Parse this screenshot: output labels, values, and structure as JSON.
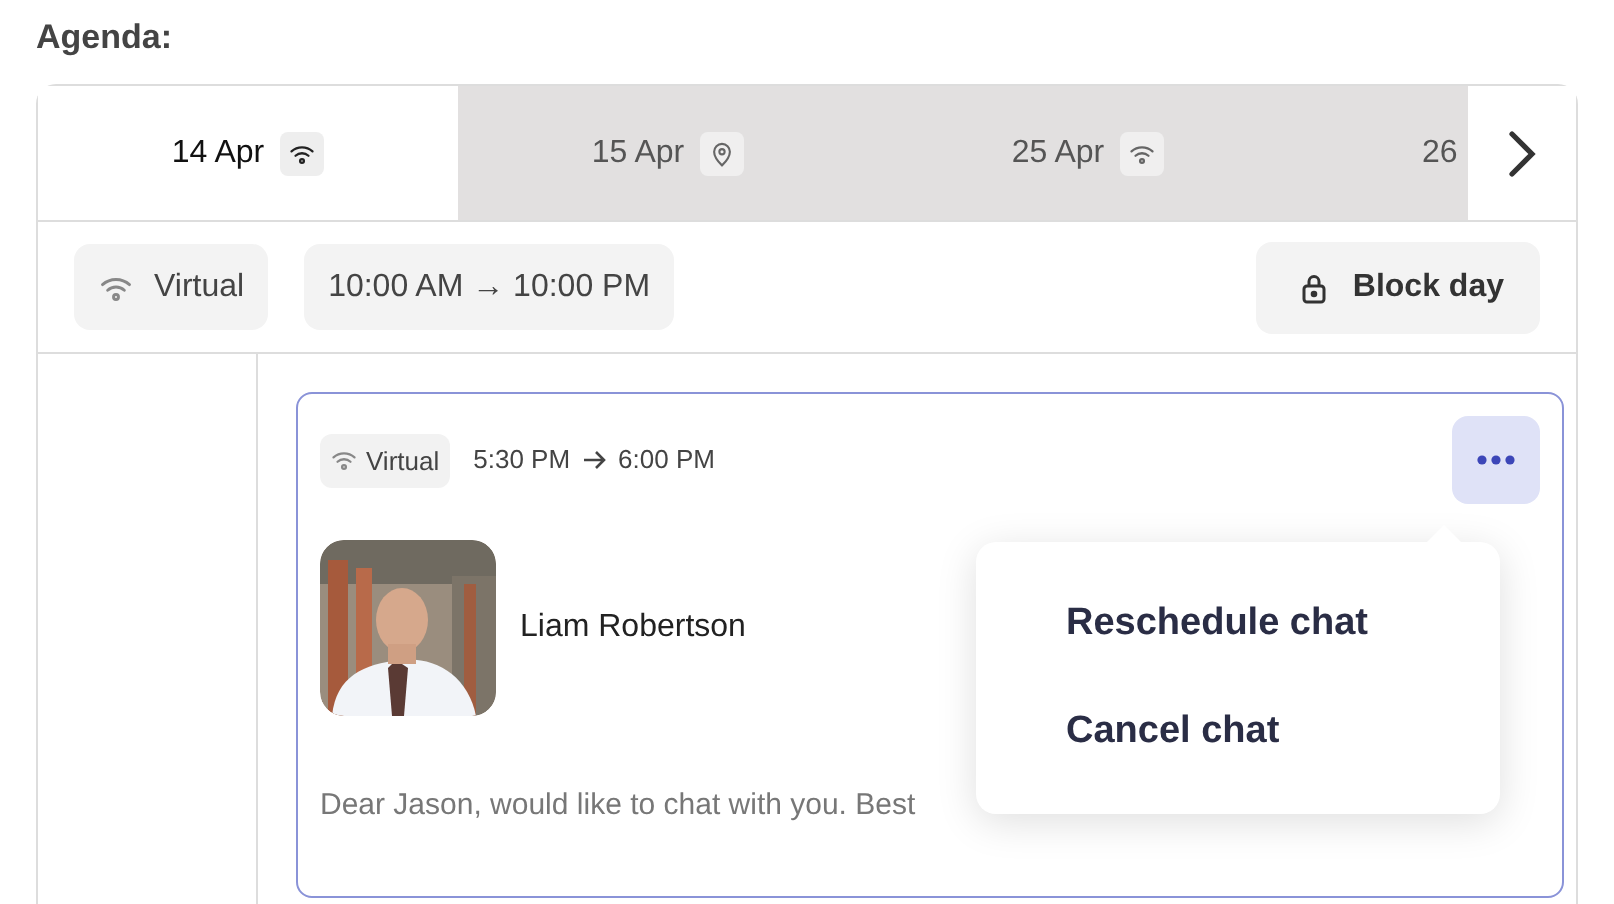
{
  "heading": "Agenda:",
  "tabs": [
    {
      "label": "14 Apr",
      "kind": "wifi",
      "selected": true
    },
    {
      "label": "15 Apr",
      "kind": "pin",
      "selected": false
    },
    {
      "label": "25 Apr",
      "kind": "wifi",
      "selected": false
    },
    {
      "label": "26",
      "selected": false
    }
  ],
  "day_bar": {
    "mode": "Virtual",
    "hours": "10:00 AM → 10:00 PM",
    "block_button": "Block day"
  },
  "chat": {
    "mode": "Virtual",
    "start": "5:30 PM",
    "end": "6:00 PM",
    "name": "Liam Robertson",
    "message": "Dear Jason, would like to chat with you. Best"
  },
  "menu": {
    "items": [
      "Reschedule chat",
      "Cancel chat"
    ]
  }
}
